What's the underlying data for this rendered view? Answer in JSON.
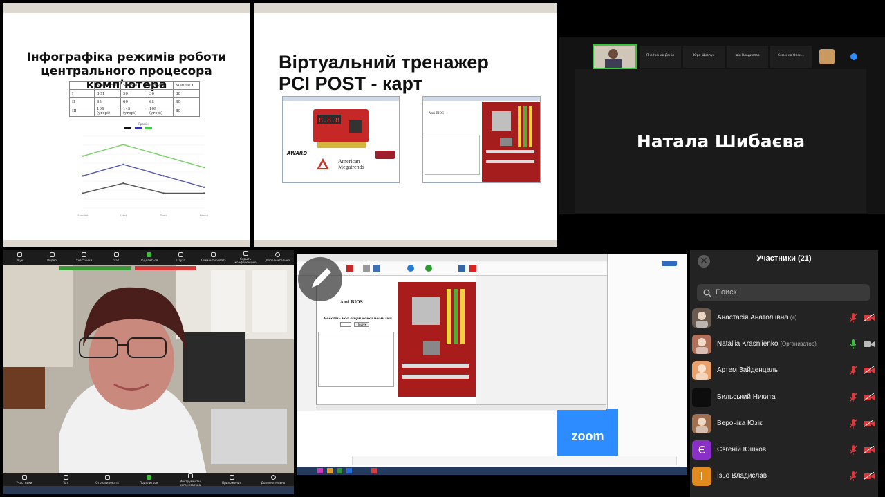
{
  "slide1": {
    "title_line1": "Інфографіка  режимів  роботи",
    "title_line2": "центрального  процесора комп’ютера",
    "table": {
      "header": [
        "",
        "Standart 1",
        "Silent 1",
        "Turbo 1",
        "Manual 1"
      ],
      "rows": [
        [
          "I",
          "3G1",
          "50",
          "30",
          "30"
        ],
        [
          "II",
          "65",
          "60",
          "65",
          "40"
        ],
        [
          "III",
          "105 (угорі)",
          "145 (угорі)",
          "105 (угорі)",
          "80"
        ]
      ]
    },
    "chart_data": {
      "type": "line",
      "title": "Графік",
      "categories": [
        "Standart",
        "Silent",
        "Turbo",
        "Manual"
      ],
      "ylim": [
        0,
        145
      ],
      "series": [
        {
          "color": "#7ccf6b",
          "values": [
            105,
            128,
            105,
            82
          ]
        },
        {
          "color": "#5555aa",
          "values": [
            65,
            88,
            65,
            42
          ]
        },
        {
          "color": "#555555",
          "values": [
            30,
            50,
            30,
            30
          ]
        }
      ],
      "legend_colors": [
        "#111111",
        "#3333bb",
        "#44cc44"
      ]
    }
  },
  "slide2": {
    "title_line1": "Віртуальний тренажер",
    "title_line2": "PCI POST - карт",
    "logo_award": "AWARD",
    "logo_ami_line1": "American",
    "logo_ami_line2": "Megatrends",
    "ami_bios": "Ami BIOS"
  },
  "speaker": {
    "name": "Натала Шибаєва",
    "mini_tiles": [
      "Ячейченко Данiл",
      "Юра Шкопук",
      "Iвiл Владислав",
      "Семенко Олек..."
    ]
  },
  "shared_screen": {
    "ami_bios": "Ami BIOS",
    "prompt": "Введіть код отриманої помилки",
    "button": "Пошук",
    "logo": "zoom"
  },
  "camera": {
    "toolbar": [
      "Звук",
      "Видео",
      "Участники",
      "Чат",
      "Поделиться",
      "Пауза",
      "Комментировать",
      "Скрыть конференцию",
      "Дополнительно"
    ],
    "bottom_toolbar": [
      "Участники",
      "Чат",
      "Отреагировать",
      "Поделиться",
      "Инструменты организатора",
      "Приложения",
      "Дополнительно"
    ]
  },
  "participants": {
    "title": "Участники (21)",
    "search_placeholder": "Поиск",
    "items": [
      {
        "name": "Анастасія Анатоліївна",
        "role": "(я)",
        "avatar": "photo",
        "avatar_color": "#6b5a4e",
        "mic": "muted",
        "video": "off"
      },
      {
        "name": "Nataliia Krasniienko",
        "role": "(Организатор)",
        "avatar": "photo",
        "avatar_color": "#b0705a",
        "mic": "on",
        "video": "on"
      },
      {
        "name": "Артем Зайденцаль",
        "role": "",
        "avatar": "cat",
        "avatar_color": "#e9a06a",
        "mic": "muted",
        "video": "off"
      },
      {
        "name": "Бильський Никита",
        "role": "",
        "avatar": "dark",
        "avatar_color": "#0d0d0d",
        "mic": "muted",
        "video": "off"
      },
      {
        "name": "Вероніка Юзік",
        "role": "",
        "avatar": "photo",
        "avatar_color": "#a07050",
        "mic": "muted",
        "video": "off"
      },
      {
        "name": "Євгеній Юшков",
        "role": "",
        "avatar": "letter",
        "letter": "Є",
        "avatar_color": "#8b2fc9",
        "mic": "muted",
        "video": "off"
      },
      {
        "name": "Ізьо Владислав",
        "role": "",
        "avatar": "letter",
        "letter": "І",
        "avatar_color": "#e08a1e",
        "mic": "muted",
        "video": "off"
      }
    ]
  }
}
